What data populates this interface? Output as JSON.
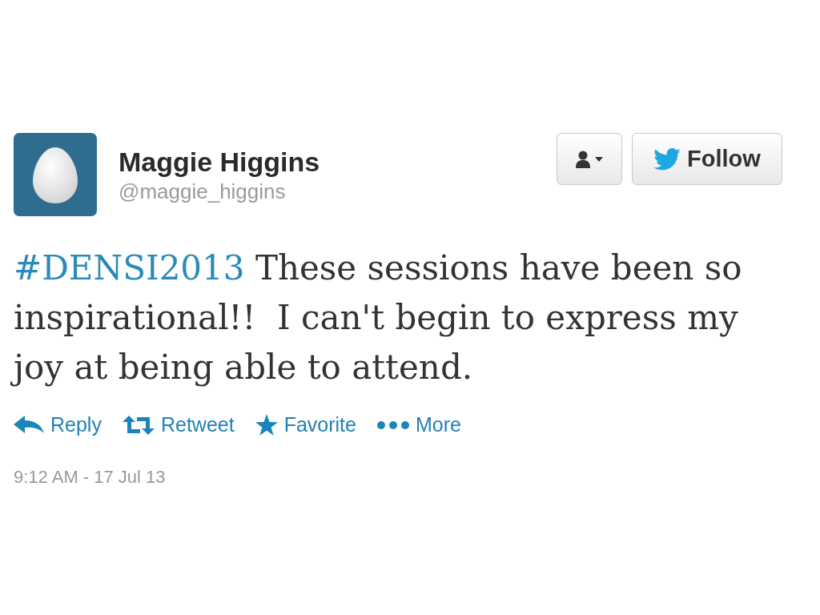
{
  "user": {
    "name": "Maggie Higgins",
    "handle": "@maggie_higgins"
  },
  "follow_button": {
    "label": "Follow"
  },
  "tweet": {
    "hashtag": "#DENSI2013",
    "text": "These sessions have been so inspirational!!  I can't begin to express my joy at being able to attend."
  },
  "actions": [
    {
      "kind": "reply",
      "label": "Reply"
    },
    {
      "kind": "retweet",
      "label": "Retweet"
    },
    {
      "kind": "favorite",
      "label": "Favorite"
    },
    {
      "kind": "more",
      "label": "More"
    }
  ],
  "timestamp": "9:12 AM - 17 Jul 13"
}
